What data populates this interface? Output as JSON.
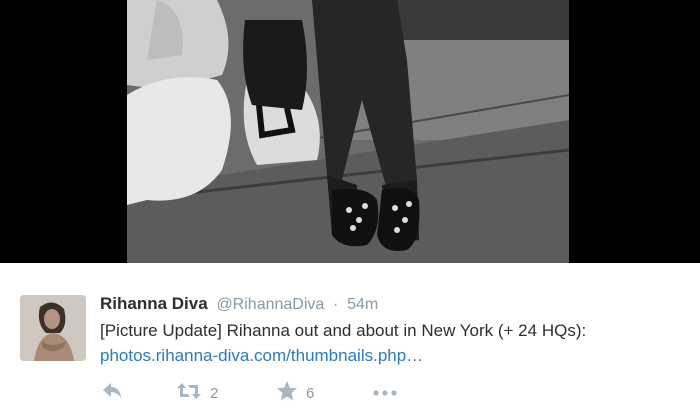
{
  "tweet": {
    "fullname": "Rihanna Diva",
    "username": "@RihannaDiva",
    "separator": "·",
    "time": "54m",
    "text": "[Picture Update] Rihanna out and about in New York (+ 24 HQs):",
    "link": "photos.rihanna-diva.com/thumbnails.php…"
  },
  "actions": {
    "retweet_count": "2",
    "favorite_count": "6"
  },
  "icons": {
    "reply": "reply-icon",
    "retweet": "retweet-icon",
    "favorite": "star-icon",
    "more": "more-icon"
  },
  "colors": {
    "name": "#292f33",
    "meta": "#8899a6",
    "link": "#2b7bb9",
    "icon": "#a7b7c4"
  }
}
